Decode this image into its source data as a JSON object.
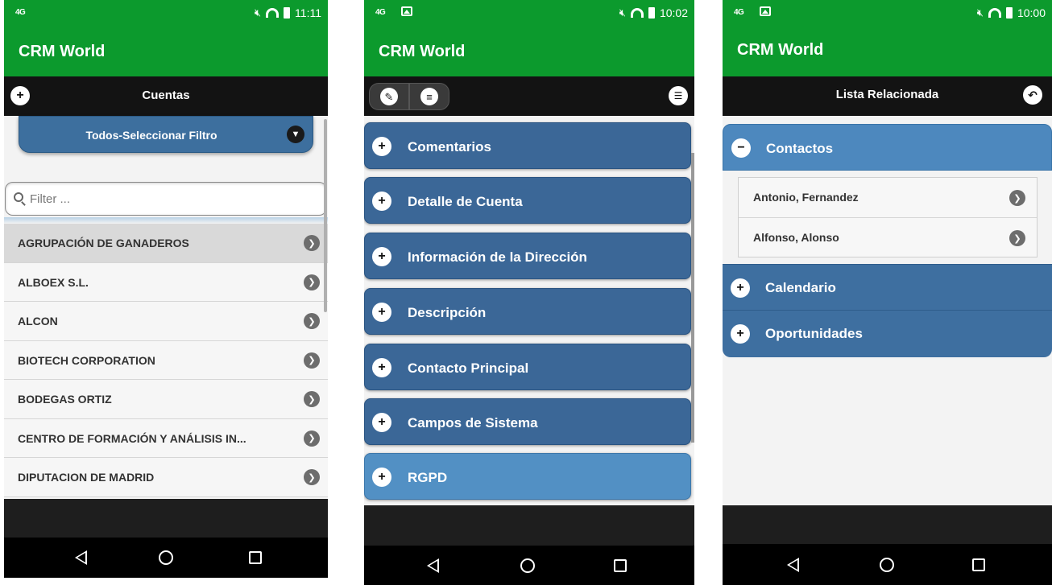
{
  "app_title": "CRM World",
  "phone1": {
    "status": {
      "network": "4G",
      "time": "11:11"
    },
    "toolbar_title": "Cuentas",
    "filter_label": "Todos-Seleccionar Filtro",
    "search_placeholder": "Filter ...",
    "accounts": [
      "AGRUPACIÓN DE GANADEROS",
      "ALBOEX S.L.",
      "ALCON",
      "BIOTECH CORPORATION",
      "BODEGAS ORTIZ",
      "CENTRO DE FORMACIÓN Y ANÁLISIS IN...",
      "DIPUTACION DE MADRID"
    ]
  },
  "phone2": {
    "status": {
      "network": "4G",
      "time": "10:02"
    },
    "sections": [
      "Comentarios",
      "Detalle de Cuenta",
      "Información de la Dirección",
      "Descripción",
      "Contacto Principal",
      "Campos de Sistema",
      "RGPD"
    ]
  },
  "phone3": {
    "status": {
      "network": "4G",
      "time": "10:00"
    },
    "toolbar_title": "Lista Relacionada",
    "contacts_header": "Contactos",
    "contacts": [
      "Antonio, Fernandez",
      "Alfonso, Alonso"
    ],
    "other_sections": [
      "Calendario",
      "Oportunidades"
    ]
  },
  "colors": {
    "app_green": "#0c9a2d",
    "header_blue": "#3b6797",
    "active_blue": "#5290c4",
    "toolbar_black": "#131313"
  }
}
